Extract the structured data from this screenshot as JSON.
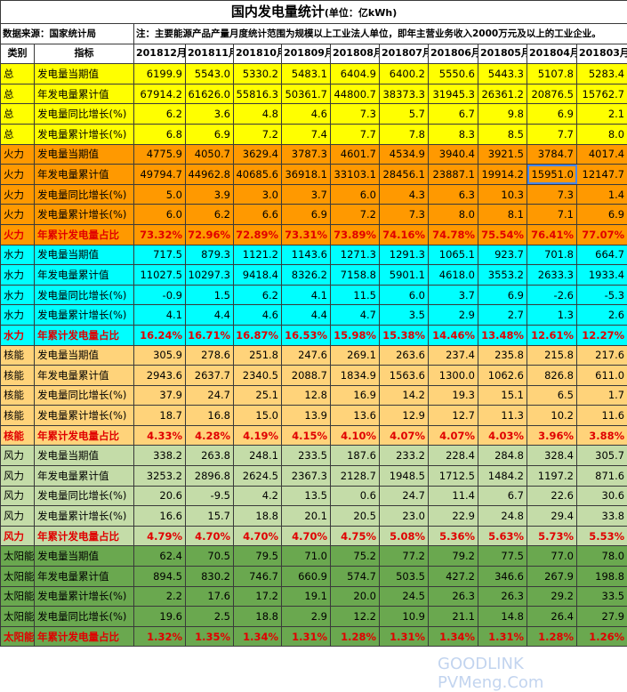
{
  "title": "国内发电量统计",
  "unit": "(单位：亿kWh)",
  "source": "数据来源：国家统计局",
  "note": "注：主要能源产品产量月度统计范围为规模以上工业法人单位，即年主营业务收入2000万元及以上的工业企业。",
  "header": {
    "category": "类别",
    "indicator": "指标",
    "months": [
      "201812月",
      "201811月",
      "201810月",
      "201809月",
      "201808月",
      "201807月",
      "201806月",
      "201805月",
      "201804月",
      "201803月"
    ]
  },
  "rows": [
    {
      "cls": "sec-total",
      "cat": "总",
      "ind": "发电量当期值",
      "v": [
        "6199.9",
        "5543.0",
        "5330.2",
        "5483.1",
        "6404.9",
        "6400.2",
        "5550.6",
        "5443.3",
        "5107.8",
        "5283.4"
      ]
    },
    {
      "cls": "sec-total",
      "cat": "总",
      "ind": "年发电量累计值",
      "v": [
        "67914.2",
        "61626.0",
        "55816.3",
        "50361.7",
        "44800.7",
        "38373.3",
        "31945.3",
        "26361.2",
        "20876.5",
        "15762.7"
      ]
    },
    {
      "cls": "sec-total",
      "cat": "总",
      "ind": "发电量同比增长(%)",
      "v": [
        "6.2",
        "3.6",
        "4.8",
        "4.6",
        "7.3",
        "5.7",
        "6.7",
        "9.8",
        "6.9",
        "2.1"
      ]
    },
    {
      "cls": "sec-total",
      "cat": "总",
      "ind": "发电量累计增长(%)",
      "v": [
        "6.8",
        "6.9",
        "7.2",
        "7.4",
        "7.7",
        "7.8",
        "8.3",
        "8.5",
        "7.7",
        "8.0"
      ]
    },
    {
      "cls": "sec-thermal",
      "cat": "火力",
      "ind": "发电量当期值",
      "v": [
        "4775.9",
        "4050.7",
        "3629.4",
        "3787.3",
        "4601.7",
        "4534.9",
        "3940.4",
        "3921.5",
        "3784.7",
        "4017.4"
      ]
    },
    {
      "cls": "sec-thermal",
      "cat": "火力",
      "ind": "年发电量累计值",
      "v": [
        "49794.7",
        "44962.8",
        "40685.6",
        "36918.1",
        "33103.1",
        "28456.1",
        "23887.1",
        "19914.2",
        "15951.0",
        "12147.7"
      ]
    },
    {
      "cls": "sec-thermal",
      "cat": "火力",
      "ind": "发电量同比增长(%)",
      "v": [
        "5.0",
        "3.9",
        "3.0",
        "3.7",
        "6.0",
        "4.3",
        "6.3",
        "10.3",
        "7.3",
        "1.4"
      ]
    },
    {
      "cls": "sec-thermal",
      "cat": "火力",
      "ind": "发电量累计增长(%)",
      "v": [
        "6.0",
        "6.2",
        "6.6",
        "6.9",
        "7.2",
        "7.3",
        "8.0",
        "8.1",
        "7.1",
        "6.9"
      ]
    },
    {
      "cls": "sec-thermal share",
      "cat": "火力",
      "ind": "年累计发电量占比",
      "v": [
        "73.32%",
        "72.96%",
        "72.89%",
        "73.31%",
        "73.89%",
        "74.16%",
        "74.78%",
        "75.54%",
        "76.41%",
        "77.07%"
      ]
    },
    {
      "cls": "sec-hydro",
      "cat": "水力",
      "ind": "发电量当期值",
      "v": [
        "717.5",
        "879.3",
        "1121.2",
        "1143.6",
        "1271.3",
        "1291.3",
        "1065.1",
        "923.7",
        "701.8",
        "664.7"
      ]
    },
    {
      "cls": "sec-hydro",
      "cat": "水力",
      "ind": "年发电量累计值",
      "v": [
        "11027.5",
        "10297.3",
        "9418.4",
        "8326.2",
        "7158.8",
        "5901.1",
        "4618.0",
        "3553.2",
        "2633.3",
        "1933.4"
      ]
    },
    {
      "cls": "sec-hydro",
      "cat": "水力",
      "ind": "发电量同比增长(%)",
      "v": [
        "-0.9",
        "1.5",
        "6.2",
        "4.1",
        "11.5",
        "6.0",
        "3.7",
        "6.9",
        "-2.6",
        "-5.3"
      ]
    },
    {
      "cls": "sec-hydro",
      "cat": "水力",
      "ind": "发电量累计增长(%)",
      "v": [
        "4.1",
        "4.4",
        "4.6",
        "4.4",
        "4.7",
        "3.5",
        "2.9",
        "2.7",
        "1.3",
        "2.6"
      ]
    },
    {
      "cls": "sec-hydro share",
      "cat": "水力",
      "ind": "年累计发电量占比",
      "v": [
        "16.24%",
        "16.71%",
        "16.87%",
        "16.53%",
        "15.98%",
        "15.38%",
        "14.46%",
        "13.48%",
        "12.61%",
        "12.27%"
      ]
    },
    {
      "cls": "sec-nuclear",
      "cat": "核能",
      "ind": "发电量当期值",
      "v": [
        "305.9",
        "278.6",
        "251.8",
        "247.6",
        "269.1",
        "263.6",
        "237.4",
        "235.8",
        "215.8",
        "217.6"
      ]
    },
    {
      "cls": "sec-nuclear",
      "cat": "核能",
      "ind": "年发电量累计值",
      "v": [
        "2943.6",
        "2637.7",
        "2340.5",
        "2088.7",
        "1834.9",
        "1563.6",
        "1300.0",
        "1062.6",
        "826.8",
        "611.0"
      ]
    },
    {
      "cls": "sec-nuclear",
      "cat": "核能",
      "ind": "发电量同比增长(%)",
      "v": [
        "37.9",
        "24.7",
        "25.1",
        "12.8",
        "16.9",
        "14.2",
        "19.3",
        "15.1",
        "6.5",
        "1.7"
      ]
    },
    {
      "cls": "sec-nuclear",
      "cat": "核能",
      "ind": "发电量累计增长(%)",
      "v": [
        "18.7",
        "16.8",
        "15.0",
        "13.9",
        "13.6",
        "12.9",
        "12.7",
        "11.3",
        "10.2",
        "11.6"
      ]
    },
    {
      "cls": "sec-nuclear share",
      "cat": "核能",
      "ind": "年累计发电量占比",
      "v": [
        "4.33%",
        "4.28%",
        "4.19%",
        "4.15%",
        "4.10%",
        "4.07%",
        "4.07%",
        "4.03%",
        "3.96%",
        "3.88%"
      ]
    },
    {
      "cls": "sec-wind",
      "cat": "风力",
      "ind": "发电量当期值",
      "v": [
        "338.2",
        "263.8",
        "248.1",
        "233.5",
        "187.6",
        "233.2",
        "228.4",
        "284.8",
        "328.4",
        "305.7"
      ]
    },
    {
      "cls": "sec-wind",
      "cat": "风力",
      "ind": "年发电量累计值",
      "v": [
        "3253.2",
        "2896.8",
        "2624.5",
        "2367.3",
        "2128.7",
        "1948.5",
        "1712.5",
        "1484.2",
        "1197.2",
        "871.6"
      ]
    },
    {
      "cls": "sec-wind",
      "cat": "风力",
      "ind": "发电量同比增长(%)",
      "v": [
        "20.6",
        "-9.5",
        "4.2",
        "13.5",
        "0.6",
        "24.7",
        "11.4",
        "6.7",
        "22.6",
        "30.6"
      ]
    },
    {
      "cls": "sec-wind",
      "cat": "风力",
      "ind": "发电量累计增长(%)",
      "v": [
        "16.6",
        "15.7",
        "18.8",
        "20.1",
        "20.5",
        "23.0",
        "22.9",
        "24.8",
        "29.4",
        "33.8"
      ]
    },
    {
      "cls": "sec-wind share",
      "cat": "风力",
      "ind": "年累计发电量占比",
      "v": [
        "4.79%",
        "4.70%",
        "4.70%",
        "4.70%",
        "4.75%",
        "5.08%",
        "5.36%",
        "5.63%",
        "5.73%",
        "5.53%"
      ]
    },
    {
      "cls": "sec-solar",
      "cat": "太阳能",
      "ind": "发电量当期值",
      "v": [
        "62.4",
        "70.5",
        "79.5",
        "71.0",
        "75.2",
        "77.2",
        "79.2",
        "77.5",
        "77.0",
        "78.0"
      ]
    },
    {
      "cls": "sec-solar",
      "cat": "太阳能",
      "ind": "年发电量累计值",
      "v": [
        "894.5",
        "830.2",
        "746.7",
        "660.9",
        "574.7",
        "503.5",
        "427.2",
        "346.6",
        "267.9",
        "198.8"
      ]
    },
    {
      "cls": "sec-solar",
      "cat": "太阳能",
      "ind": "发电量累计增长(%)",
      "v": [
        "2.2",
        "17.6",
        "17.2",
        "19.1",
        "20.0",
        "24.5",
        "26.3",
        "26.3",
        "29.2",
        "33.5"
      ]
    },
    {
      "cls": "sec-solar",
      "cat": "太阳能",
      "ind": "发电量同比增长(%)",
      "v": [
        "19.6",
        "2.5",
        "18.8",
        "2.9",
        "12.2",
        "10.9",
        "21.1",
        "14.8",
        "26.4",
        "27.9"
      ]
    },
    {
      "cls": "sec-solar share",
      "cat": "太阳能",
      "ind": "年累计发电量占比",
      "v": [
        "1.32%",
        "1.35%",
        "1.34%",
        "1.31%",
        "1.28%",
        "1.31%",
        "1.34%",
        "1.31%",
        "1.28%",
        "1.26%"
      ]
    }
  ],
  "watermark_left": "GoodLink PVMeng.Com",
  "watermark_right": "GOODLINK PVMeng.Com"
}
